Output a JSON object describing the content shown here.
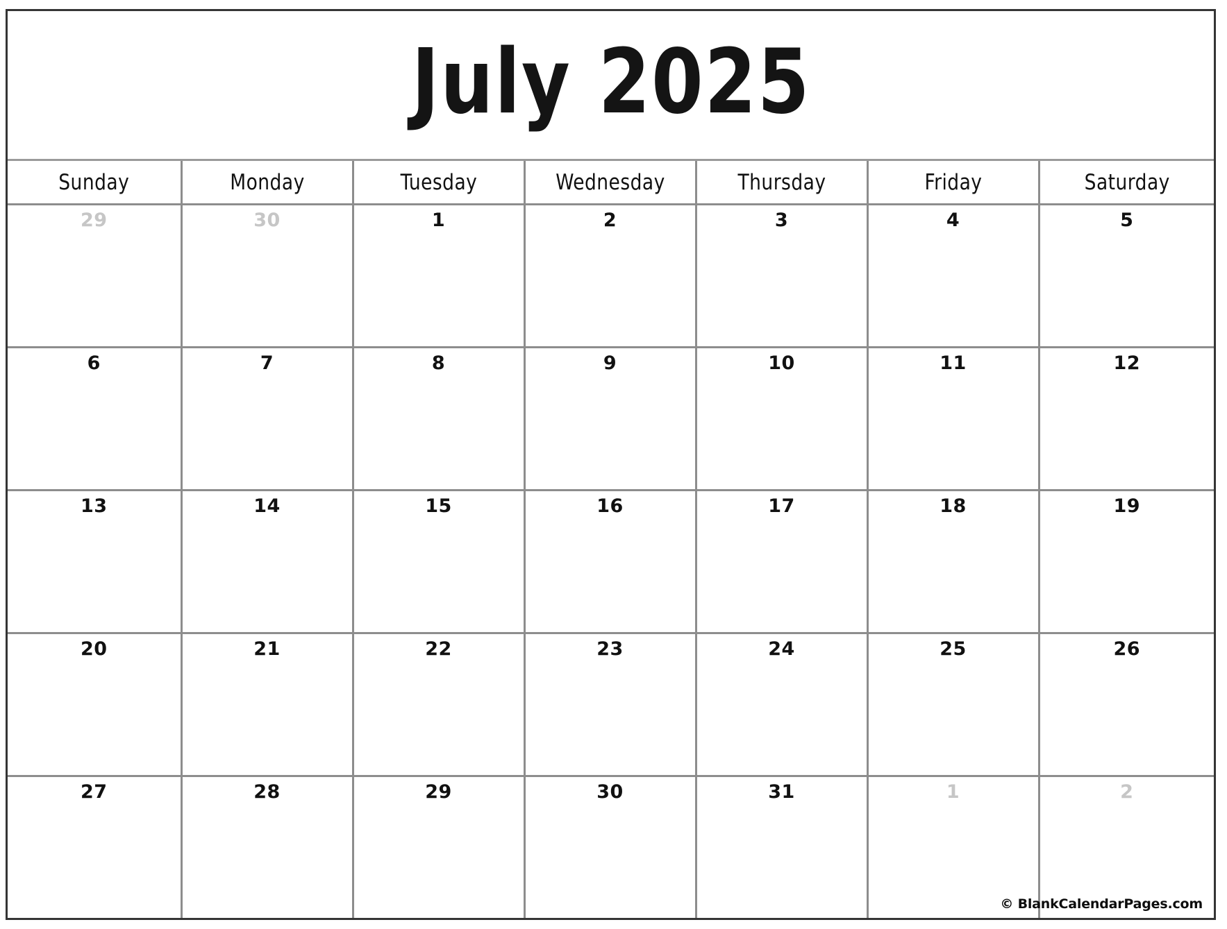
{
  "calendar": {
    "title": "July 2025",
    "month": "July",
    "year": "2025",
    "weekdays": [
      "Sunday",
      "Monday",
      "Tuesday",
      "Wednesday",
      "Thursday",
      "Friday",
      "Saturday"
    ],
    "weeks": [
      [
        {
          "num": "29",
          "muted": true
        },
        {
          "num": "30",
          "muted": true
        },
        {
          "num": "1",
          "muted": false
        },
        {
          "num": "2",
          "muted": false
        },
        {
          "num": "3",
          "muted": false
        },
        {
          "num": "4",
          "muted": false
        },
        {
          "num": "5",
          "muted": false
        }
      ],
      [
        {
          "num": "6",
          "muted": false
        },
        {
          "num": "7",
          "muted": false
        },
        {
          "num": "8",
          "muted": false
        },
        {
          "num": "9",
          "muted": false
        },
        {
          "num": "10",
          "muted": false
        },
        {
          "num": "11",
          "muted": false
        },
        {
          "num": "12",
          "muted": false
        }
      ],
      [
        {
          "num": "13",
          "muted": false
        },
        {
          "num": "14",
          "muted": false
        },
        {
          "num": "15",
          "muted": false
        },
        {
          "num": "16",
          "muted": false
        },
        {
          "num": "17",
          "muted": false
        },
        {
          "num": "18",
          "muted": false
        },
        {
          "num": "19",
          "muted": false
        }
      ],
      [
        {
          "num": "20",
          "muted": false
        },
        {
          "num": "21",
          "muted": false
        },
        {
          "num": "22",
          "muted": false
        },
        {
          "num": "23",
          "muted": false
        },
        {
          "num": "24",
          "muted": false
        },
        {
          "num": "25",
          "muted": false
        },
        {
          "num": "26",
          "muted": false
        }
      ],
      [
        {
          "num": "27",
          "muted": false
        },
        {
          "num": "28",
          "muted": false
        },
        {
          "num": "29",
          "muted": false
        },
        {
          "num": "30",
          "muted": false
        },
        {
          "num": "31",
          "muted": false
        },
        {
          "num": "1",
          "muted": true
        },
        {
          "num": "2",
          "muted": true
        }
      ]
    ],
    "credit": "© BlankCalendarPages.com",
    "colors": {
      "outer_border": "#353535",
      "grid_line": "#8d8d8d",
      "text": "#111111",
      "muted_text": "#c6c6c6",
      "background": "#ffffff"
    }
  }
}
